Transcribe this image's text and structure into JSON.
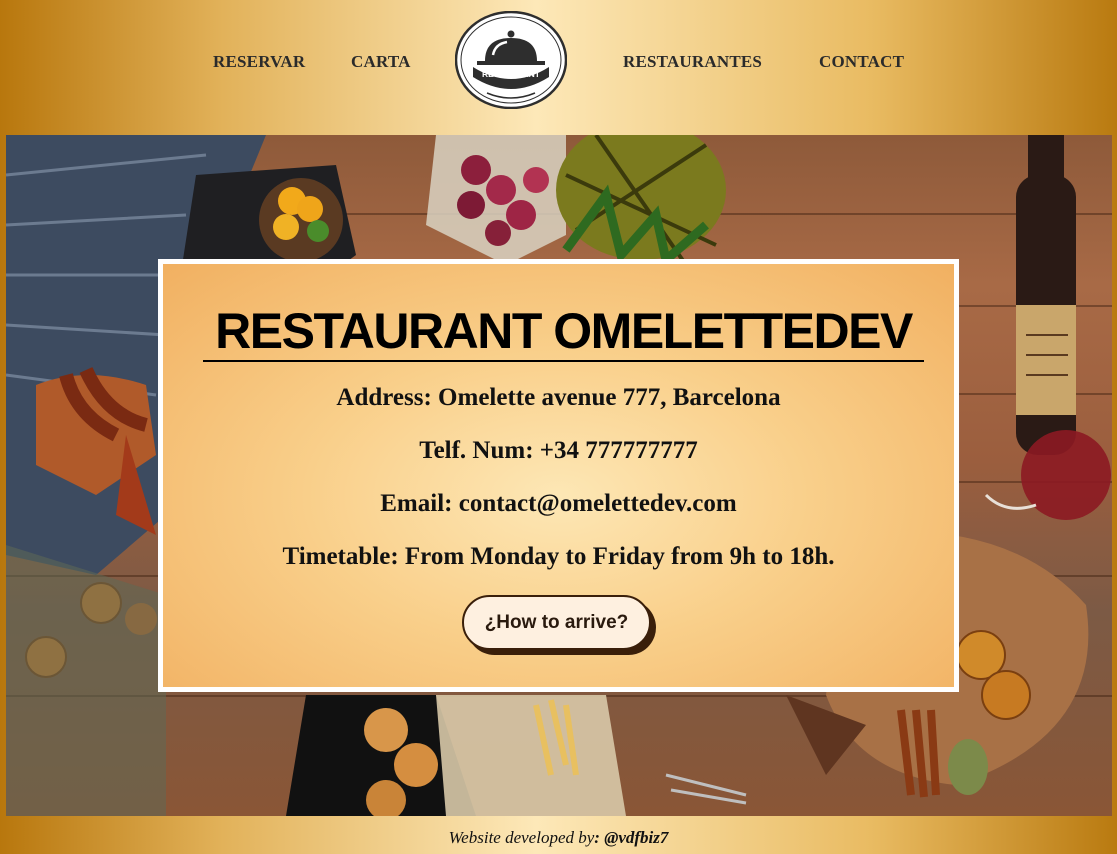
{
  "nav": {
    "reservar": "RESERVAR",
    "carta": "CARTA",
    "restaurantes": "RESTAURANTES",
    "contact": "CONTACT"
  },
  "logo": {
    "text": "RESTAURANT",
    "icon": "cloche-icon"
  },
  "hero": {
    "background": "restaurant-table-food-photo"
  },
  "card": {
    "title": "RESTAURANT OMELETTEDEV",
    "address": "Address: Omelette avenue 777, Barcelona",
    "phone": "Telf. Num: +34 777777777",
    "email": "Email: contact@omelettedev.com",
    "timetable": "Timetable: From Monday to Friday from 9h to 18h.",
    "button_label": "¿How to arrive?"
  },
  "footer": {
    "prefix": "Website developed by",
    "handle": ": @vdfbiz7"
  },
  "colors": {
    "gold_dark": "#b8770d",
    "gold_light": "#fde8b8",
    "card_border": "#ffffff",
    "button_shadow": "#3a1f0a"
  }
}
